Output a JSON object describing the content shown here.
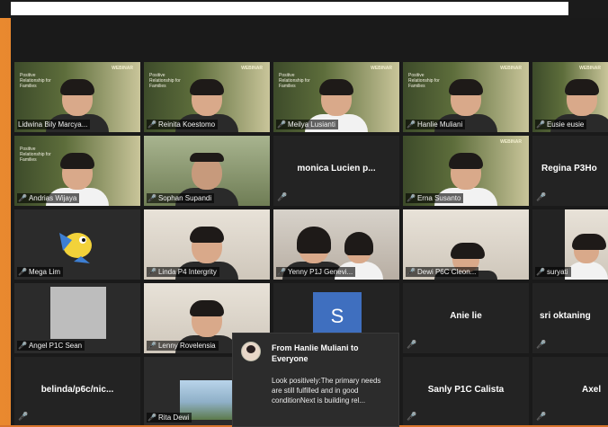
{
  "participants": [
    {
      "name": "Lidwina Bily Marcya...",
      "active": true
    },
    {
      "name": "Reinita Koestomo"
    },
    {
      "name": "Meilya Lusianti"
    },
    {
      "name": "Hanlie Muliani"
    },
    {
      "name": "Eusie eusie"
    },
    {
      "name": "Andrias Wijaya"
    },
    {
      "name": "Sophan Supandi"
    },
    {
      "name": "monica  Lucien p..."
    },
    {
      "name": "Erna Susanto"
    },
    {
      "name": "Regina P3Ho"
    },
    {
      "name": "Mega Lim"
    },
    {
      "name": "Linda P4 Intergrity"
    },
    {
      "name": "Yenny P1J Genevi..."
    },
    {
      "name": "Dewi P6C Cleon..."
    },
    {
      "name": "suryati"
    },
    {
      "name": "Angel P1C Sean"
    },
    {
      "name": "Lenny Rovelensia"
    },
    {
      "name": "S"
    },
    {
      "name": "Anie lie"
    },
    {
      "name": "sri oktaning"
    },
    {
      "name": "belinda/p6c/nic..."
    },
    {
      "name": "Rita Dewi"
    },
    {
      "name": "Sanly P1C Calista"
    },
    {
      "name": "Axel"
    }
  ],
  "webinar_banner": {
    "tag": "WEBINAR",
    "text": "Positive Relationship for Families"
  },
  "chat": {
    "title": "From Hanlie Muliani to Everyone",
    "message": "Look positively:The primary needs are still fulfilled and in good conditionNext is building rel..."
  },
  "colors": {
    "active_border": "#b9d44a",
    "muted_mic": "#e0393e",
    "background": "#1a1a1a"
  }
}
